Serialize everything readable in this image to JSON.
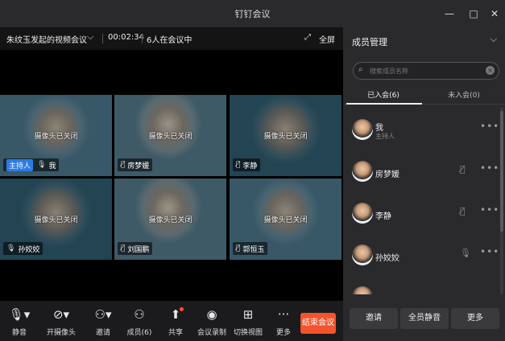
{
  "window": {
    "title": "钉钉会议",
    "minimize": "—",
    "maximize": "□",
    "close": "✕"
  },
  "infobar": {
    "meeting_title": "朱纹玉发起的视频会议",
    "timer": "00:02:34",
    "participant_count": "6人在会议中",
    "fullscreen_label": "全屏"
  },
  "tiles": [
    {
      "camera_off": "摄像头已关闭",
      "name": "我",
      "host_badge": "主持人",
      "mic_muted": false
    },
    {
      "camera_off": "摄像头已关闭",
      "name": "房梦媛",
      "mic_muted": true
    },
    {
      "camera_off": "摄像头已关闭",
      "name": "李静",
      "mic_muted": true
    },
    {
      "camera_off": "摄像头已关闭",
      "name": "孙姣姣",
      "mic_muted": false
    },
    {
      "camera_off": "摄像头已关闭",
      "name": "刘国鹏",
      "mic_muted": true
    },
    {
      "camera_off": "摄像头已关闭",
      "name": "郭恒玉",
      "mic_muted": true
    }
  ],
  "toolbar": {
    "items": [
      {
        "label": "静音",
        "icon": "microphone-icon"
      },
      {
        "label": "开摄像头",
        "icon": "camera-off-icon"
      },
      {
        "label": "邀请",
        "icon": "add-user-icon"
      },
      {
        "label": "成员(6)",
        "icon": "members-icon"
      },
      {
        "label": "共享",
        "icon": "share-screen-icon"
      },
      {
        "label": "会议录制",
        "icon": "record-icon"
      },
      {
        "label": "切换视图",
        "icon": "grid-view-icon"
      },
      {
        "label": "更多",
        "icon": "more-icon"
      }
    ],
    "end_label": "结束会议",
    "end_color": "#f5532d"
  },
  "panel": {
    "title": "成员管理",
    "search_placeholder": "搜索成员名称",
    "tabs": [
      {
        "label": "已入会(6)",
        "active": true
      },
      {
        "label": "未入会(0)",
        "active": false
      }
    ],
    "members": [
      {
        "name": "我",
        "role": "主持人",
        "mic_muted": false
      },
      {
        "name": "房梦媛",
        "role": "",
        "mic_muted": true
      },
      {
        "name": "李静",
        "role": "",
        "mic_muted": true
      },
      {
        "name": "孙姣姣",
        "role": "",
        "mic_muted": false
      },
      {
        "name": "",
        "role": "",
        "mic_muted": false
      }
    ],
    "buttons": {
      "invite": "邀请",
      "mute_all": "全员静音",
      "more": "更多"
    }
  }
}
